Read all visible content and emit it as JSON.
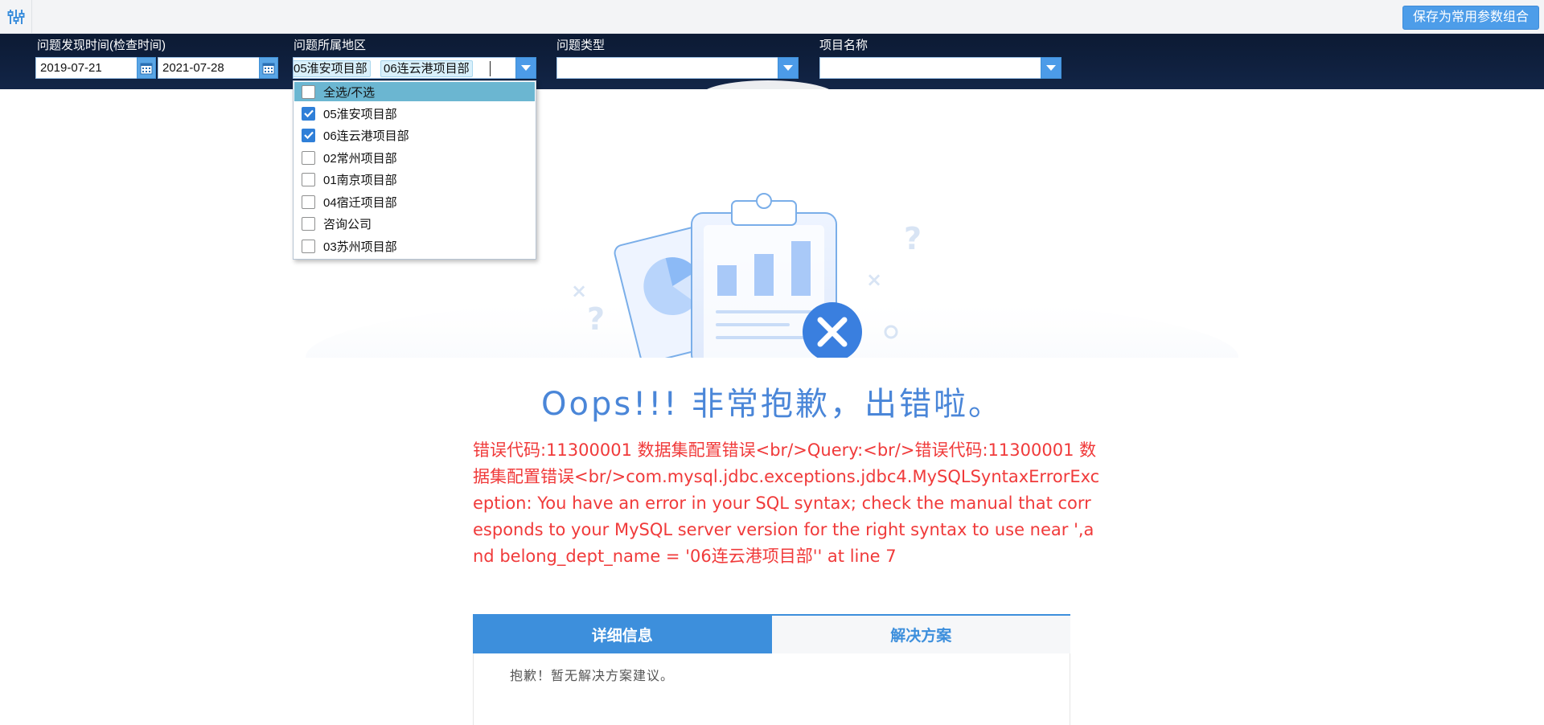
{
  "toolbar": {
    "settings_icon": "sliders-icon",
    "save_button": "保存为常用参数组合"
  },
  "filters": {
    "date": {
      "label": "问题发现时间(检查时间)",
      "start": "2019-07-21",
      "end": "2021-07-28",
      "icon": "calendar-icon"
    },
    "region": {
      "label": "问题所属地区",
      "selected_tags": [
        "05淮安项目部",
        "06连云港项目部"
      ],
      "options": [
        {
          "label": "全选/不选",
          "checked": false,
          "highlighted": true
        },
        {
          "label": "05淮安项目部",
          "checked": true,
          "highlighted": false
        },
        {
          "label": "06连云港项目部",
          "checked": true,
          "highlighted": false
        },
        {
          "label": "02常州项目部",
          "checked": false,
          "highlighted": false
        },
        {
          "label": "01南京项目部",
          "checked": false,
          "highlighted": false
        },
        {
          "label": "04宿迁项目部",
          "checked": false,
          "highlighted": false
        },
        {
          "label": "咨询公司",
          "checked": false,
          "highlighted": false
        },
        {
          "label": "03苏州项目部",
          "checked": false,
          "highlighted": false
        }
      ]
    },
    "problem_type": {
      "label": "问题类型",
      "value": ""
    },
    "project_name": {
      "label": "项目名称",
      "value": ""
    }
  },
  "error": {
    "title": "Oops!!! 非常抱歉，出错啦。",
    "message": "错误代码:11300001 数据集配置错误<br/>Query:<br/>错误代码:11300001 数据集配置错误<br/>com.mysql.jdbc.exceptions.jdbc4.MySQLSyntaxErrorException: You have an error in your SQL syntax; check the manual that corresponds to your MySQL server version for the right syntax to use near ',and belong_dept_name = '06连云港项目部'' at line 7",
    "illustration": "error-clipboard-illustration"
  },
  "tabs": {
    "detail": "详细信息",
    "solution": "解决方案",
    "panel_text": "抱歉！暂无解决方案建议。"
  },
  "colors": {
    "accent": "#3d8fdc",
    "error_text": "#f03a3a",
    "header_bg": "#0c1a33"
  }
}
